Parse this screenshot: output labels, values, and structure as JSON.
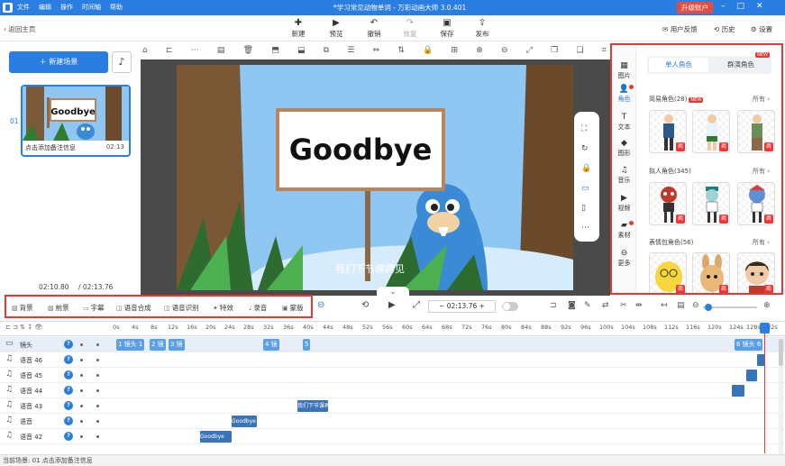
{
  "titlebar": {
    "menu": [
      "文件",
      "编辑",
      "操作",
      "时间轴",
      "帮助"
    ],
    "title": "*学习常见动物单词 - 万彩动画大师 3.0.401",
    "upgrade": "升级账户"
  },
  "toolbar": {
    "back": "返回主页",
    "new": "新建",
    "preview": "预览",
    "undo": "撤销",
    "redo": "恢复",
    "save": "保存",
    "publish": "发布",
    "feedback": "用户反馈",
    "history": "历史",
    "settings": "设置"
  },
  "scenes": {
    "new_scene": "新建场景",
    "items": [
      {
        "num": "01",
        "caption": "点击添加备注信息",
        "duration": "02:13",
        "sign": "Goodbye"
      }
    ],
    "current_time": "02:10.80",
    "total_time": "/ 02:13.76"
  },
  "stage": {
    "sign": "Goodbye",
    "subtitle": "我们下节课再见"
  },
  "right_panel": {
    "tabs": [
      "图片",
      "角色",
      "文本",
      "图形",
      "音乐",
      "视频",
      "素材",
      "更多"
    ],
    "active_tab": "角色",
    "segment": [
      "单人角色",
      "群演角色"
    ],
    "new_badge": "NEW",
    "more": "所有",
    "shang": "商",
    "categories": [
      {
        "name": "简易角色(28)",
        "badge": "NEW"
      },
      {
        "name": "拟人角色(345)",
        "badge": ""
      },
      {
        "name": "表情包角色(56)",
        "badge": ""
      }
    ]
  },
  "timeline_tools": [
    "背景",
    "前景",
    "字幕",
    "语音合成",
    "语音识别",
    "特效",
    "录音",
    "蒙版"
  ],
  "timecode": "02:13.76",
  "ruler": [
    "0s",
    "4s",
    "8s",
    "12s",
    "16s",
    "20s",
    "24s",
    "28s",
    "32s",
    "36s",
    "40s",
    "44s",
    "48s",
    "52s",
    "56s",
    "60s",
    "64s",
    "68s",
    "72s",
    "76s",
    "80s",
    "84s",
    "88s",
    "92s",
    "96s",
    "100s",
    "104s",
    "108s",
    "112s",
    "116s",
    "120s",
    "124s",
    "128s",
    "132s"
  ],
  "tracks": [
    {
      "label": "镜头",
      "type": "lens"
    },
    {
      "label": "语音 46",
      "type": "audio"
    },
    {
      "label": "语音 45",
      "type": "audio"
    },
    {
      "label": "语音 44",
      "type": "audio"
    },
    {
      "label": "语音 43",
      "type": "audio"
    },
    {
      "label": "语音",
      "type": "audio"
    },
    {
      "label": "语音 42",
      "type": "audio"
    }
  ],
  "lens_blocks": [
    "1 镜头 1",
    "2 镜",
    "3 镜",
    "4 镜",
    "5",
    "6 镜头 6"
  ],
  "clips": {
    "v43": "我们下节课再见",
    "v": "Goodbye",
    "v42": "Goodbye"
  },
  "status": "当前场景: 01    点击添加备注信息"
}
